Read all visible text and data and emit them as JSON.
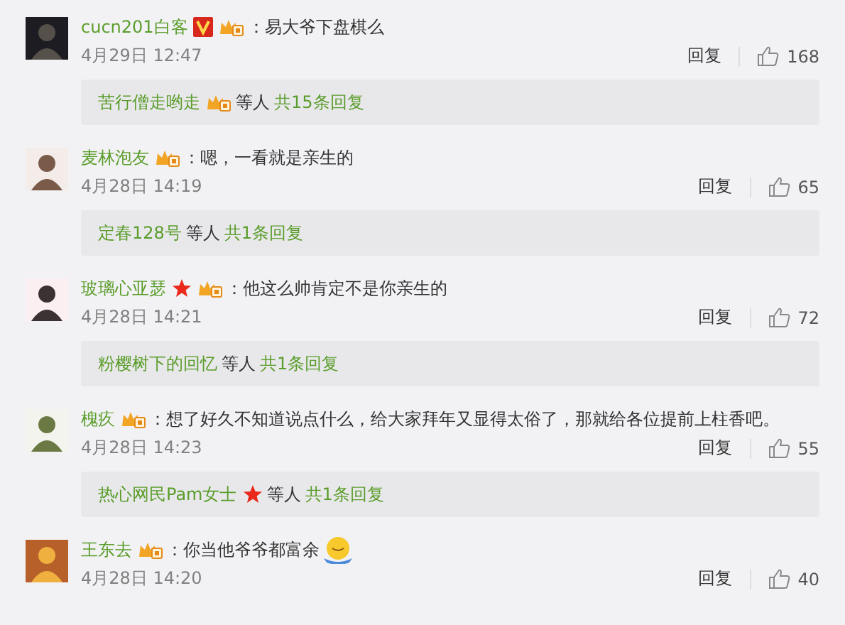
{
  "comments": [
    {
      "name": "cucn201白客",
      "badges": [
        {
          "kind": "verified"
        },
        {
          "kind": "vip"
        }
      ],
      "text": "：易大爷下盘棋么",
      "trailing_emoji": false,
      "time": "4月29日 12:47",
      "reply_label": "回复",
      "likes": "168",
      "replies": {
        "names": [
          {
            "name": "苦行僧走哟走",
            "badges": [
              {
                "kind": "vip"
              }
            ]
          }
        ],
        "suffix": "等人",
        "total": "共15条回复"
      }
    },
    {
      "name": "麦林泡友",
      "badges": [
        {
          "kind": "vip"
        }
      ],
      "text": "：嗯，一看就是亲生的",
      "trailing_emoji": false,
      "time": "4月28日 14:19",
      "reply_label": "回复",
      "likes": "65",
      "replies": {
        "names": [
          {
            "name": "定春128号"
          }
        ],
        "suffix": "等人",
        "total": "共1条回复"
      }
    },
    {
      "name": "玻璃心亚瑟",
      "badges": [
        {
          "kind": "star"
        },
        {
          "kind": "vip"
        }
      ],
      "text": "：他这么帅肯定不是你亲生的",
      "trailing_emoji": false,
      "time": "4月28日 14:21",
      "reply_label": "回复",
      "likes": "72",
      "replies": {
        "names": [
          {
            "name": "粉樱树下的回忆"
          }
        ],
        "suffix": "等人",
        "total": "共1条回复"
      }
    },
    {
      "name": "槐疚",
      "badges": [
        {
          "kind": "vip"
        }
      ],
      "text": "：想了好久不知道说点什么，给大家拜年又显得太俗了，那就给各位提前上柱香吧。",
      "trailing_emoji": false,
      "time": "4月28日 14:23",
      "reply_label": "回复",
      "likes": "55",
      "replies": {
        "names": [
          {
            "name": "热心网民Pam女士",
            "badges": [
              {
                "kind": "star"
              }
            ]
          }
        ],
        "suffix": "等人",
        "total": "共1条回复"
      }
    },
    {
      "name": "王东去",
      "badges": [
        {
          "kind": "vip"
        }
      ],
      "text": "：你当他爷爷都富余",
      "trailing_emoji": true,
      "time": "4月28日 14:20",
      "reply_label": "回复",
      "likes": "40"
    }
  ]
}
